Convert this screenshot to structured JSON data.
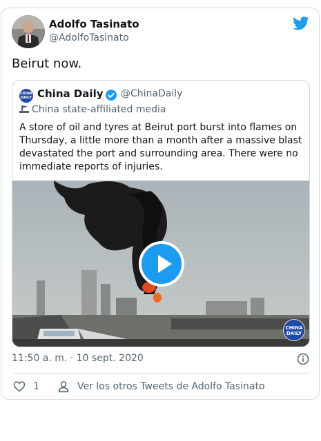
{
  "tweet": {
    "author_name": "Adolfo Tasinato",
    "author_handle": "@AdolfoTasinato",
    "text": "Beirut now.",
    "timestamp": "11:50 a. m. · 10 sept. 2020",
    "like_count": "1",
    "more_tweets_label": "Ver los otros Tweets de Adolfo Tasinato"
  },
  "quote": {
    "name": "China Daily",
    "handle": "@ChinaDaily",
    "state_label": "China state-affiliated media",
    "text": "A store of oil and tyres at Beirut port burst into flames on Thursday, a little more than a month after a massive blast devastated the port and surrounding area. There were no immediate reports of injuries.",
    "logo_text_line1": "CHINA",
    "logo_text_line2": "DAILY"
  },
  "icons": {
    "brand": "twitter-bird-icon",
    "verified": "verified-badge-icon",
    "state": "flag-stand-icon",
    "play": "play-icon",
    "info": "info-icon",
    "like": "heart-icon",
    "profile": "person-icon"
  },
  "colors": {
    "accent": "#1d9bf0",
    "text": "#0f1419",
    "secondary": "#536471",
    "border": "#cfd9de"
  }
}
